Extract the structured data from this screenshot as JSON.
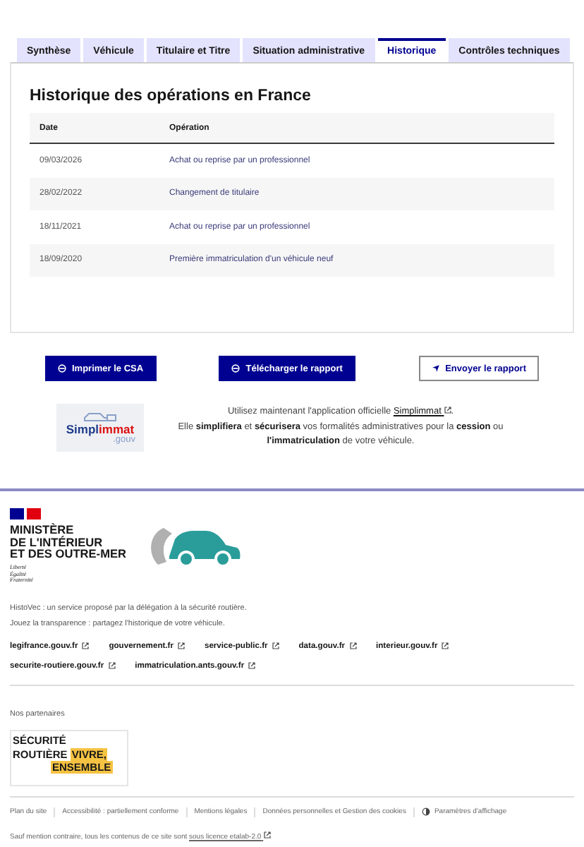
{
  "tabs": [
    {
      "label": "Synthèse",
      "selected": false
    },
    {
      "label": "Véhicule",
      "selected": false
    },
    {
      "label": "Titulaire et Titre",
      "selected": false
    },
    {
      "label": "Situation administrative",
      "selected": false
    },
    {
      "label": "Historique",
      "selected": true
    },
    {
      "label": "Contrôles techniques",
      "selected": false
    }
  ],
  "history": {
    "title": "Historique des opérations en France",
    "columns": [
      "Date",
      "Opération"
    ],
    "rows": [
      {
        "date": "09/03/2026",
        "operation": "Achat ou reprise par un professionnel"
      },
      {
        "date": "28/02/2022",
        "operation": "Changement de titulaire"
      },
      {
        "date": "18/11/2021",
        "operation": "Achat ou reprise par un professionnel"
      },
      {
        "date": "18/09/2020",
        "operation": "Première immatriculation d'un véhicule neuf"
      }
    ]
  },
  "actions": [
    {
      "label": "Imprimer le CSA",
      "kind": "primary"
    },
    {
      "label": "Télécharger le rapport",
      "kind": "primary"
    },
    {
      "label": "Envoyer le rapport",
      "kind": "secondary"
    }
  ],
  "promo": {
    "logo_name": "Simpl",
    "logo_accent": "immat",
    "logo_suffix": ".gouv",
    "intro": "Utilisez maintenant l'application officielle",
    "link": "Simplimmat",
    "after_link": ".",
    "body": "Elle **simplifiera** et **sécurisera** vos formalités administratives pour la **cession** ou **l'immatriculation** de votre véhicule."
  },
  "footer": {
    "ministry": [
      "MINISTÈRE",
      "DE L'INTÉRIEUR",
      "ET DES OUTRE-MER"
    ],
    "motto": [
      "Liberté",
      "Égalité",
      "Fraternité"
    ],
    "description": [
      "HistoVec : un service proposé par la délégation à la sécurité routière.",
      "Jouez la transparence : partagez l'historique de votre véhicule."
    ],
    "links": [
      "legifrance.gouv.fr",
      "gouvernement.fr",
      "service-public.fr",
      "data.gouv.fr",
      "interieur.gouv.fr",
      "securite-routiere.gouv.fr",
      "immatriculation.ants.gouv.fr"
    ],
    "partners_label": "Nos partenaires",
    "partner_logo": {
      "line_1": "SÉCURITÉ",
      "line_2": "ROUTIÈRE",
      "accent_1": "VIVRE,",
      "accent_2": "ENSEMBLE"
    },
    "bottom_links": [
      "Plan du site",
      "Accessibilité : partiellement conforme",
      "Mentions légales",
      "Données personnelles et Gestion des cookies"
    ],
    "display_settings": "Paramètres d'affichage",
    "license_text": "Sauf mention contraire, tous les contenus de ce site sont",
    "license_link": "sous licence etalab-2.0"
  }
}
